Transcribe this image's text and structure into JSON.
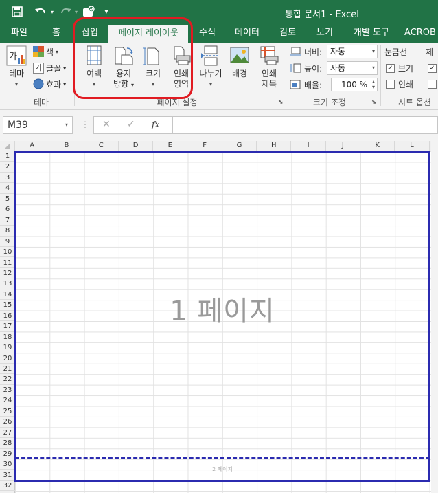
{
  "titlebar": {
    "title": "통합 문서1 - Excel",
    "save_icon": "save-icon",
    "undo_icon": "undo-icon",
    "redo_icon": "redo-icon",
    "touch_icon": "touch-mode-icon",
    "customize_icon": "customize-qat-icon"
  },
  "tabs": [
    {
      "label": "파일"
    },
    {
      "label": "홈"
    },
    {
      "label": "삽입"
    },
    {
      "label": "페이지 레이아웃"
    },
    {
      "label": "수식"
    },
    {
      "label": "데이터"
    },
    {
      "label": "검토"
    },
    {
      "label": "보기"
    },
    {
      "label": "개발 도구"
    },
    {
      "label": "ACROB"
    }
  ],
  "ribbon": {
    "theme": {
      "theme_label": "테마",
      "colors_label": "색",
      "fonts_label": "글꼴",
      "effects_label": "효과",
      "group_label": "테마"
    },
    "page_setup": {
      "margins_label": "여백",
      "orientation_label_1": "용지",
      "orientation_label_2": "방향",
      "size_label": "크기",
      "print_area_label_1": "인쇄",
      "print_area_label_2": "영역",
      "breaks_label": "나누기",
      "background_label": "배경",
      "print_titles_label_1": "인쇄",
      "print_titles_label_2": "제목",
      "group_label": "페이지 설정"
    },
    "scale": {
      "width_label": "너비:",
      "width_value": "자동",
      "height_label": "높이:",
      "height_value": "자동",
      "scale_label": "배율:",
      "scale_value": "100 %",
      "group_label": "크기 조정"
    },
    "sheet_options": {
      "gridlines_label": "눈금선",
      "headings_label": "제",
      "view_label": "보기",
      "print_label": "인쇄",
      "group_label": "시트 옵션"
    }
  },
  "formula_bar": {
    "name_box": "M39",
    "cancel_icon": "✕",
    "enter_icon": "✓",
    "fx_label": "fx",
    "formula": ""
  },
  "sheet": {
    "columns": [
      "A",
      "B",
      "C",
      "D",
      "E",
      "F",
      "G",
      "H",
      "I",
      "J",
      "K",
      "L"
    ],
    "rows": [
      "1",
      "2",
      "3",
      "4",
      "5",
      "6",
      "7",
      "8",
      "9",
      "10",
      "11",
      "12",
      "13",
      "14",
      "15",
      "16",
      "17",
      "18",
      "19",
      "20",
      "21",
      "22",
      "23",
      "24",
      "25",
      "26",
      "27",
      "28",
      "29",
      "30",
      "31",
      "32"
    ],
    "page_watermark": "1 페이지",
    "page2_watermark": "2 페이지"
  },
  "colors": {
    "excel_green": "#217346",
    "highlight_red": "#e11b22",
    "page_border_blue": "#2b2bb0"
  }
}
